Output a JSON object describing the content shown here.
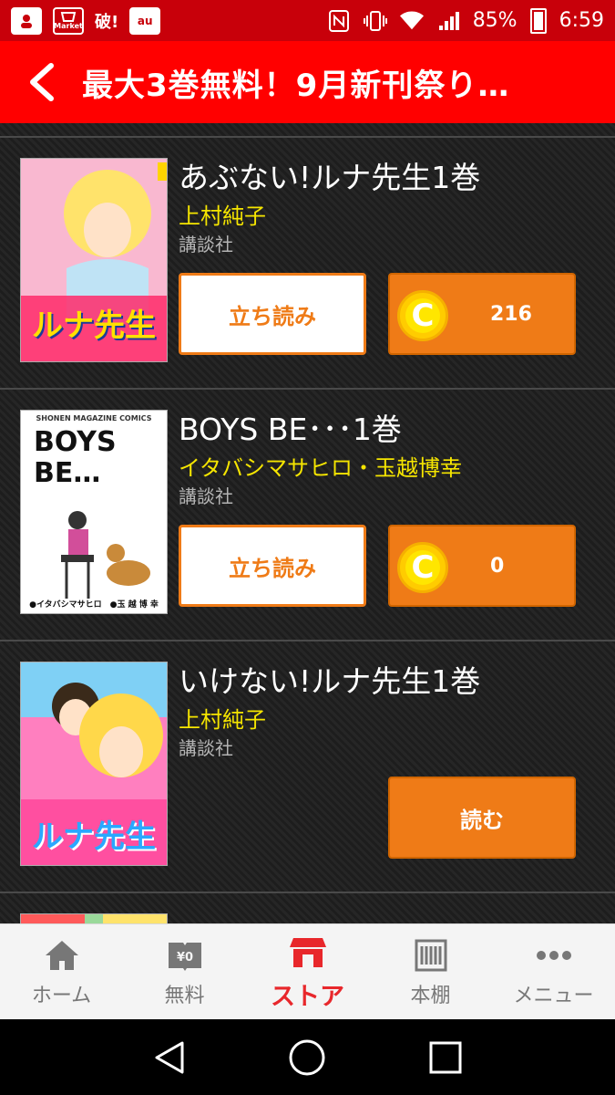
{
  "status_bar": {
    "app_icons": [
      "contacts-icon",
      "market-icon",
      "haretsu-icon",
      "au-icon"
    ],
    "market_label": "Market",
    "haretsu_label": "破!",
    "au_label": "au",
    "battery": "85%",
    "time": "6:59"
  },
  "header": {
    "title": "最大3巻無料！9月新刊祭り…"
  },
  "books": [
    {
      "title": "あぶない!ルナ先生1巻",
      "author": "上村純子",
      "publisher": "講談社",
      "cover_text": "ルナ先生",
      "tachiyomi_label": "立ち読み",
      "coin_letter": "C",
      "price": "216",
      "colors": {
        "cover": "#f7a8c6"
      }
    },
    {
      "title": "BOYS BE･･･1巻",
      "author": "イタバシマサヒロ・玉越博幸",
      "publisher": "講談社",
      "cover_text": "BOYS BE…",
      "cover_sub": "SHONEN MAGAZINE COMICS",
      "cover_bottom": "●イタバシマサヒロ　●玉 越 博 幸",
      "tachiyomi_label": "立ち読み",
      "coin_letter": "C",
      "price": "0"
    },
    {
      "title": "いけない!ルナ先生1巻",
      "author": "上村純子",
      "publisher": "講談社",
      "cover_text": "ルナ先生",
      "read_label": "読む"
    }
  ],
  "bottom_nav": {
    "items": [
      {
        "label": "ホーム",
        "icon": "home-icon"
      },
      {
        "label": "無料",
        "icon": "free-book-icon",
        "badge": "¥0"
      },
      {
        "label": "ストア",
        "icon": "store-icon",
        "active": true
      },
      {
        "label": "本棚",
        "icon": "bookshelf-icon"
      },
      {
        "label": "メニュー",
        "icon": "more-icon"
      }
    ]
  },
  "system_nav": [
    "back-triangle-icon",
    "home-circle-icon",
    "recents-square-icon"
  ],
  "colors": {
    "status_bar": "#c8000a",
    "header": "#ff0000",
    "accent_orange": "#ef7b17",
    "author_yellow": "#f5e500",
    "nav_active": "#e8272b"
  }
}
